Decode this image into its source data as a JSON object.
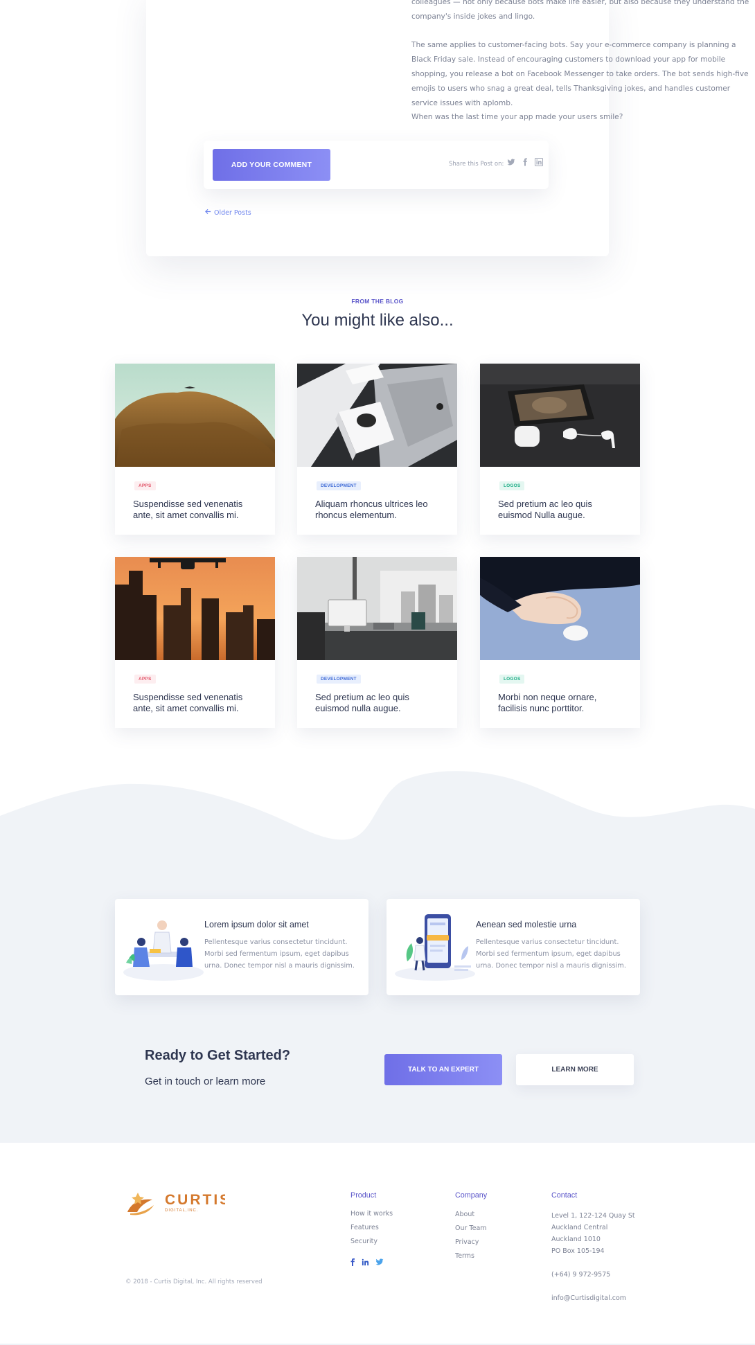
{
  "article": {
    "paragraph1": "colleagues — not only because bots make life easier, but also because they understand the company's inside jokes and lingo.",
    "paragraph2": "The same applies to customer-facing bots. Say your e-commerce company is planning a Black Friday sale. Instead of encouraging customers to download your app for mobile shopping, you release a bot on Facebook Messenger to take orders. The bot sends high-five emojis to users who snag a great deal, tells Thanksgiving jokes, and handles customer service issues with aplomb.",
    "paragraph3": "When was the last time your app made your users smile?",
    "add_comment_label": "ADD YOUR COMMENT",
    "share_label": "Share this Post on:",
    "share_icons": [
      "twitter-icon",
      "facebook-icon",
      "linkedin-icon"
    ],
    "older_posts_label": "Older Posts"
  },
  "blog": {
    "eyebrow": "FROM THE BLOG",
    "title": "You might like also...",
    "posts": [
      {
        "tag": "APPS",
        "title": "Suspendisse sed venenatis ante, sit amet convallis mi.",
        "image": "mountain-drone-photo"
      },
      {
        "tag": "DEVELOPMENT",
        "title": "Aliquam rhoncus ultrices leo rhoncus elementum.",
        "image": "devices-desk-photo"
      },
      {
        "tag": "LOGOS",
        "title": "Sed pretium ac leo quis euismod Nulla augue.",
        "image": "phone-earbuds-photo"
      },
      {
        "tag": "APPS",
        "title": "Suspendisse sed venenatis ante, sit amet convallis mi.",
        "image": "drone-sunset-photo"
      },
      {
        "tag": "DEVELOPMENT",
        "title": "Sed pretium ac leo quis euismod nulla augue.",
        "image": "office-desk-photo"
      },
      {
        "tag": "LOGOS",
        "title": "Morbi non neque ornare, facilisis nunc porttitor.",
        "image": "hand-mouse-photo"
      }
    ]
  },
  "features": [
    {
      "title": "Lorem ipsum dolor sit amet",
      "description": "Pellentesque varius consectetur tincidunt. Morbi sed fermentum ipsum, eget dapibus urna. Donec tempor nisl a mauris dignissim.",
      "illustration": "team-meeting-illustration"
    },
    {
      "title": "Aenean sed molestie urna",
      "description": "Pellentesque varius consectetur tincidunt. Morbi sed fermentum ipsum, eget dapibus urna. Donec tempor nisl a mauris dignissim.",
      "illustration": "mobile-app-illustration"
    }
  ],
  "cta": {
    "title": "Ready to Get Started?",
    "subtitle": "Get in touch or learn more",
    "primary_label": "TALK TO AN EXPERT",
    "secondary_label": "LEARN MORE"
  },
  "footer": {
    "logo_text": "CURTIS",
    "logo_subtext": "DIGITAL,INC.",
    "copyright": "© 2018 - Curtis Digital, Inc. All rights reserved",
    "product": {
      "title": "Product",
      "links": [
        "How it works",
        "Features",
        "Security"
      ]
    },
    "company": {
      "title": "Company",
      "links": [
        "About",
        "Our Team",
        "Privacy",
        "Terms"
      ]
    },
    "contact": {
      "title": "Contact",
      "address": [
        "Level 1, 122-124 Quay St",
        "Auckland Central",
        "Auckland 1010",
        "PO Box 105-194"
      ],
      "phone": "(+64) 9 972-9575",
      "email": "info@Curtisdigital.com"
    },
    "social_icons": [
      "facebook-icon",
      "linkedin-icon",
      "twitter-icon"
    ]
  },
  "colors": {
    "accent": "#6f6fe7",
    "brand_orange": "#d4782c",
    "band_background": "#f0f3f7"
  }
}
